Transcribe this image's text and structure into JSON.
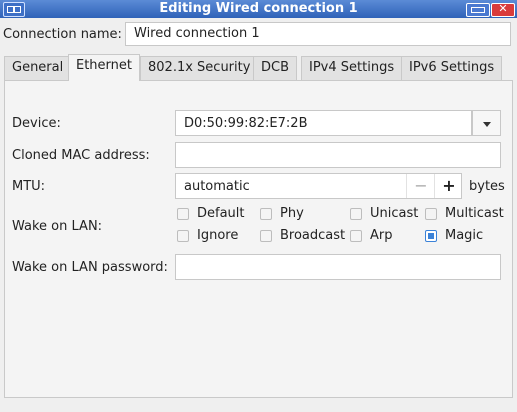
{
  "window": {
    "title": "Editing Wired connection 1"
  },
  "connection": {
    "name_label": "Connection name:",
    "name_value": "Wired connection 1"
  },
  "tabs": [
    {
      "label": "General"
    },
    {
      "label": "Ethernet",
      "active": true
    },
    {
      "label": "802.1x Security"
    },
    {
      "label": "DCB"
    },
    {
      "label": "IPv4 Settings"
    },
    {
      "label": "IPv6 Settings"
    }
  ],
  "ethernet": {
    "device_label": "Device:",
    "device_value": "D0:50:99:82:E7:2B",
    "cloned_mac_label": "Cloned MAC address:",
    "cloned_mac_value": "",
    "mtu_label": "MTU:",
    "mtu_value": "automatic",
    "mtu_minus": "−",
    "mtu_plus": "+",
    "mtu_unit": "bytes",
    "wol_label": "Wake on LAN:",
    "wol_options": [
      {
        "label": "Default",
        "checked": false
      },
      {
        "label": "Phy",
        "checked": false
      },
      {
        "label": "Unicast",
        "checked": false
      },
      {
        "label": "Multicast",
        "checked": false
      },
      {
        "label": "Ignore",
        "checked": false
      },
      {
        "label": "Broadcast",
        "checked": false
      },
      {
        "label": "Arp",
        "checked": false
      },
      {
        "label": "Magic",
        "checked": true
      }
    ],
    "wol_password_label": "Wake on LAN password:",
    "wol_password_value": ""
  },
  "colors": {
    "titlebar": "#2f62b8",
    "accent": "#3b82d8",
    "close": "#d93b3b"
  }
}
